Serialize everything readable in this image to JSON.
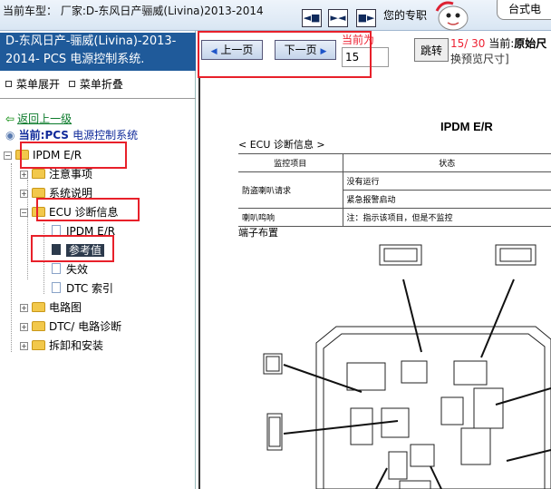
{
  "topbar": {
    "car_label": "当前车型：  厂家:D-东风日产骊威(Livina)2013-2014",
    "nav_icons": [
      "jump-start-icon",
      "jump-both-icon",
      "jump-end-icon"
    ],
    "pro_label": "您的专职",
    "bubble_text": "台式电"
  },
  "sidebar": {
    "title": "D-东风日产-骊威(Livina)-2013-2014- PCS 电源控制系统.",
    "expand_label": "菜单展开",
    "collapse_label": "菜单折叠",
    "back_label": "返回上一级",
    "current_prefix": "当前:PCS",
    "current_system": "电源控制系统",
    "tree": [
      {
        "label": "IPDM E/R",
        "type": "folder",
        "expanded": true
      },
      {
        "label": "注意事项",
        "type": "folder"
      },
      {
        "label": "系统说明",
        "type": "folder"
      },
      {
        "label": "ECU 诊断信息",
        "type": "folder",
        "expanded": true
      },
      {
        "label": "IPDM E/R",
        "type": "doc"
      },
      {
        "label": "参考值",
        "type": "doc",
        "selected": true
      },
      {
        "label": "失效",
        "type": "doc"
      },
      {
        "label": "DTC 索引",
        "type": "doc"
      },
      {
        "label": "电路图",
        "type": "folder"
      },
      {
        "label": "DTC/ 电路诊断",
        "type": "folder"
      },
      {
        "label": "拆卸和安装",
        "type": "folder"
      }
    ]
  },
  "pager": {
    "prev_label": "上一页",
    "next_label": "下一页",
    "current_page_label": "当前为",
    "page_value": "15",
    "jump_label": "跳转",
    "page_count": "15/ 30",
    "current_label": "当前:",
    "original_label": "原始尺",
    "preview_note": "换预览尺寸]"
  },
  "document": {
    "title": "IPDM E/R",
    "ecu_heading": "< ECU 诊断信息 >",
    "table": {
      "headers": [
        "监控项目",
        "状态"
      ],
      "rows": [
        [
          "防盗喇叭请求",
          "没有运行"
        ],
        [
          "",
          "紧急报警启动"
        ],
        [
          "喇叭鸣响",
          "注：指示该项目，但是不监控"
        ]
      ]
    },
    "terminal_label": "端子布置"
  },
  "colors": {
    "accent_blue": "#1f5a9a",
    "highlight_red": "#e8202a",
    "selected_bg": "#2c3a4c",
    "link_green": "#0a7a2a"
  }
}
